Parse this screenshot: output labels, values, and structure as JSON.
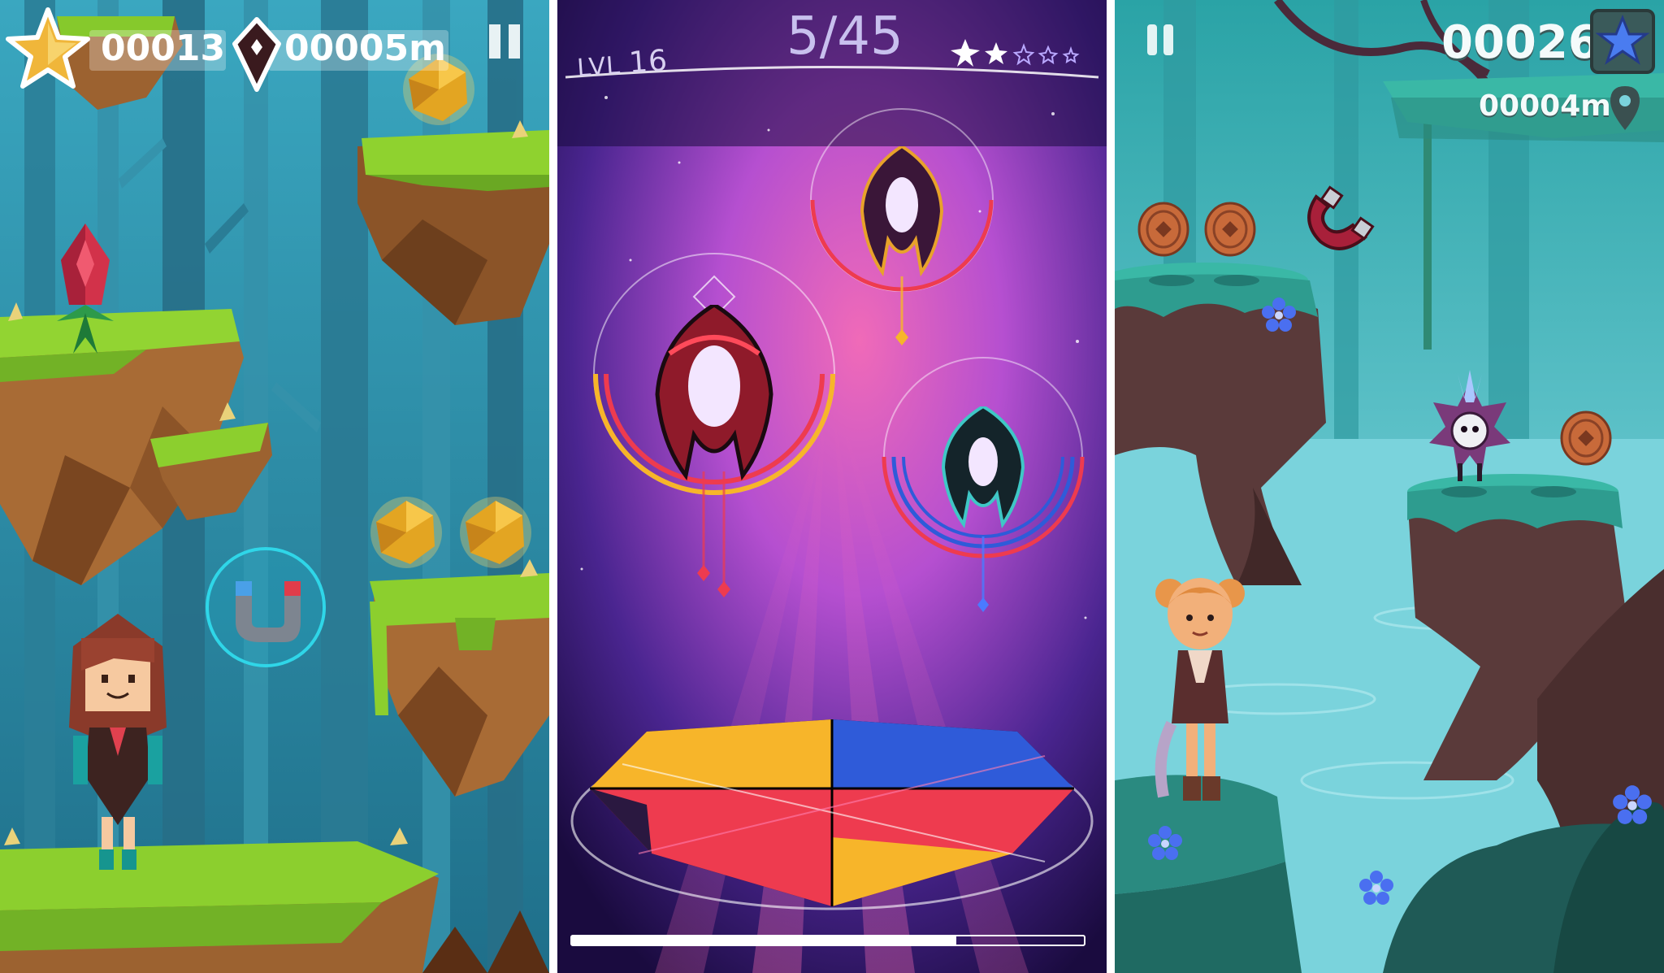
{
  "panels": [
    {
      "name": "lowpoly-forest-runner",
      "hud": {
        "star_count": "00013",
        "distance": "00005m"
      },
      "icons": [
        "star-icon",
        "gem-marker-icon",
        "pause-icon",
        "magnet-icon",
        "coin-icon",
        "thorn-flower-icon"
      ],
      "colors": {
        "sky": "#2f8fa8",
        "grass": "#8ccf2e",
        "dirt": "#a86b35",
        "coin": "#e3a522"
      }
    },
    {
      "name": "space-rhythm-shooter",
      "hud": {
        "level_prefix": "LVL",
        "level_number": "16",
        "wave_progress": "5/45"
      },
      "progress_fraction": 0.75,
      "star_rating": {
        "filled": 2,
        "total": 5
      },
      "icons": [
        "spark-star-icon",
        "alien-ship-icon",
        "crystal-shield-icon"
      ],
      "colors": {
        "space": "#3b1a6b",
        "nebula": "#d94fa3",
        "red": "#ee3b4f",
        "yellow": "#f7b52a",
        "blue": "#2f5bd9"
      }
    },
    {
      "name": "cartoon-swamp-runner",
      "hud": {
        "score": "00026",
        "distance": "00004m"
      },
      "icons": [
        "pause-icon",
        "blue-flower-badge-icon",
        "map-pin-icon",
        "bronze-coin-icon",
        "magnet-icon",
        "fluffy-creature-icon",
        "heroine-icon"
      ],
      "colors": {
        "water": "#7ad3dc",
        "moss": "#2fa49a",
        "trunk": "#5a3a3a",
        "coin": "#c86a3a"
      }
    }
  ]
}
